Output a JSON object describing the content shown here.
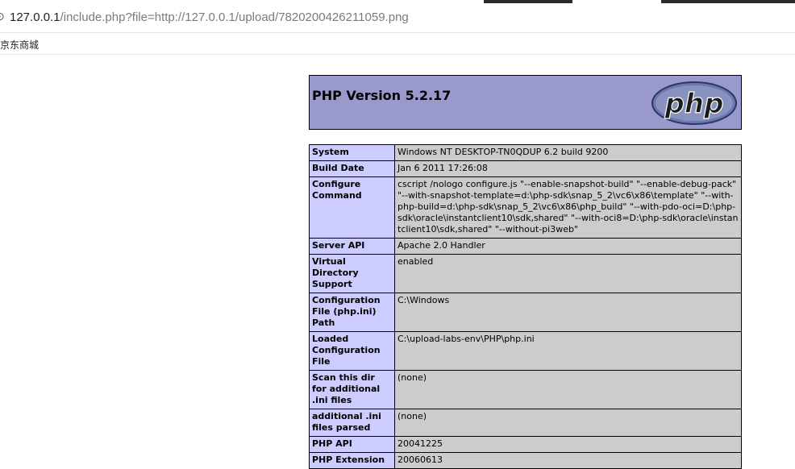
{
  "browser": {
    "url_host": "127.0.0.1",
    "url_rest": "/include.php?file=http://127.0.0.1/upload/7820200426211059.png",
    "bookmark": "京东商城"
  },
  "header": {
    "title": "PHP Version 5.2.17",
    "logo_text": "php"
  },
  "rows": [
    {
      "label": "System",
      "value": "Windows NT DESKTOP-TN0QDUP 6.2 build 9200"
    },
    {
      "label": "Build Date",
      "value": "Jan 6 2011 17:26:08"
    },
    {
      "label": "Configure Command",
      "value": "cscript /nologo configure.js \"--enable-snapshot-build\" \"--enable-debug-pack\" \"--with-snapshot-template=d:\\php-sdk\\snap_5_2\\vc6\\x86\\template\" \"--with-php-build=d:\\php-sdk\\snap_5_2\\vc6\\x86\\php_build\" \"--with-pdo-oci=D:\\php-sdk\\oracle\\instantclient10\\sdk,shared\" \"--with-oci8=D:\\php-sdk\\oracle\\instantclient10\\sdk,shared\" \"--without-pi3web\""
    },
    {
      "label": "Server API",
      "value": "Apache 2.0 Handler"
    },
    {
      "label": "Virtual Directory Support",
      "value": "enabled"
    },
    {
      "label": "Configuration File (php.ini) Path",
      "value": "C:\\Windows"
    },
    {
      "label": "Loaded Configuration File",
      "value": "C:\\upload-labs-env\\PHP\\php.ini"
    },
    {
      "label": "Scan this dir for additional .ini files",
      "value": "(none)"
    },
    {
      "label": "additional .ini files parsed",
      "value": "(none)"
    },
    {
      "label": "PHP API",
      "value": "20041225"
    },
    {
      "label": "PHP Extension",
      "value": "20060613"
    }
  ]
}
